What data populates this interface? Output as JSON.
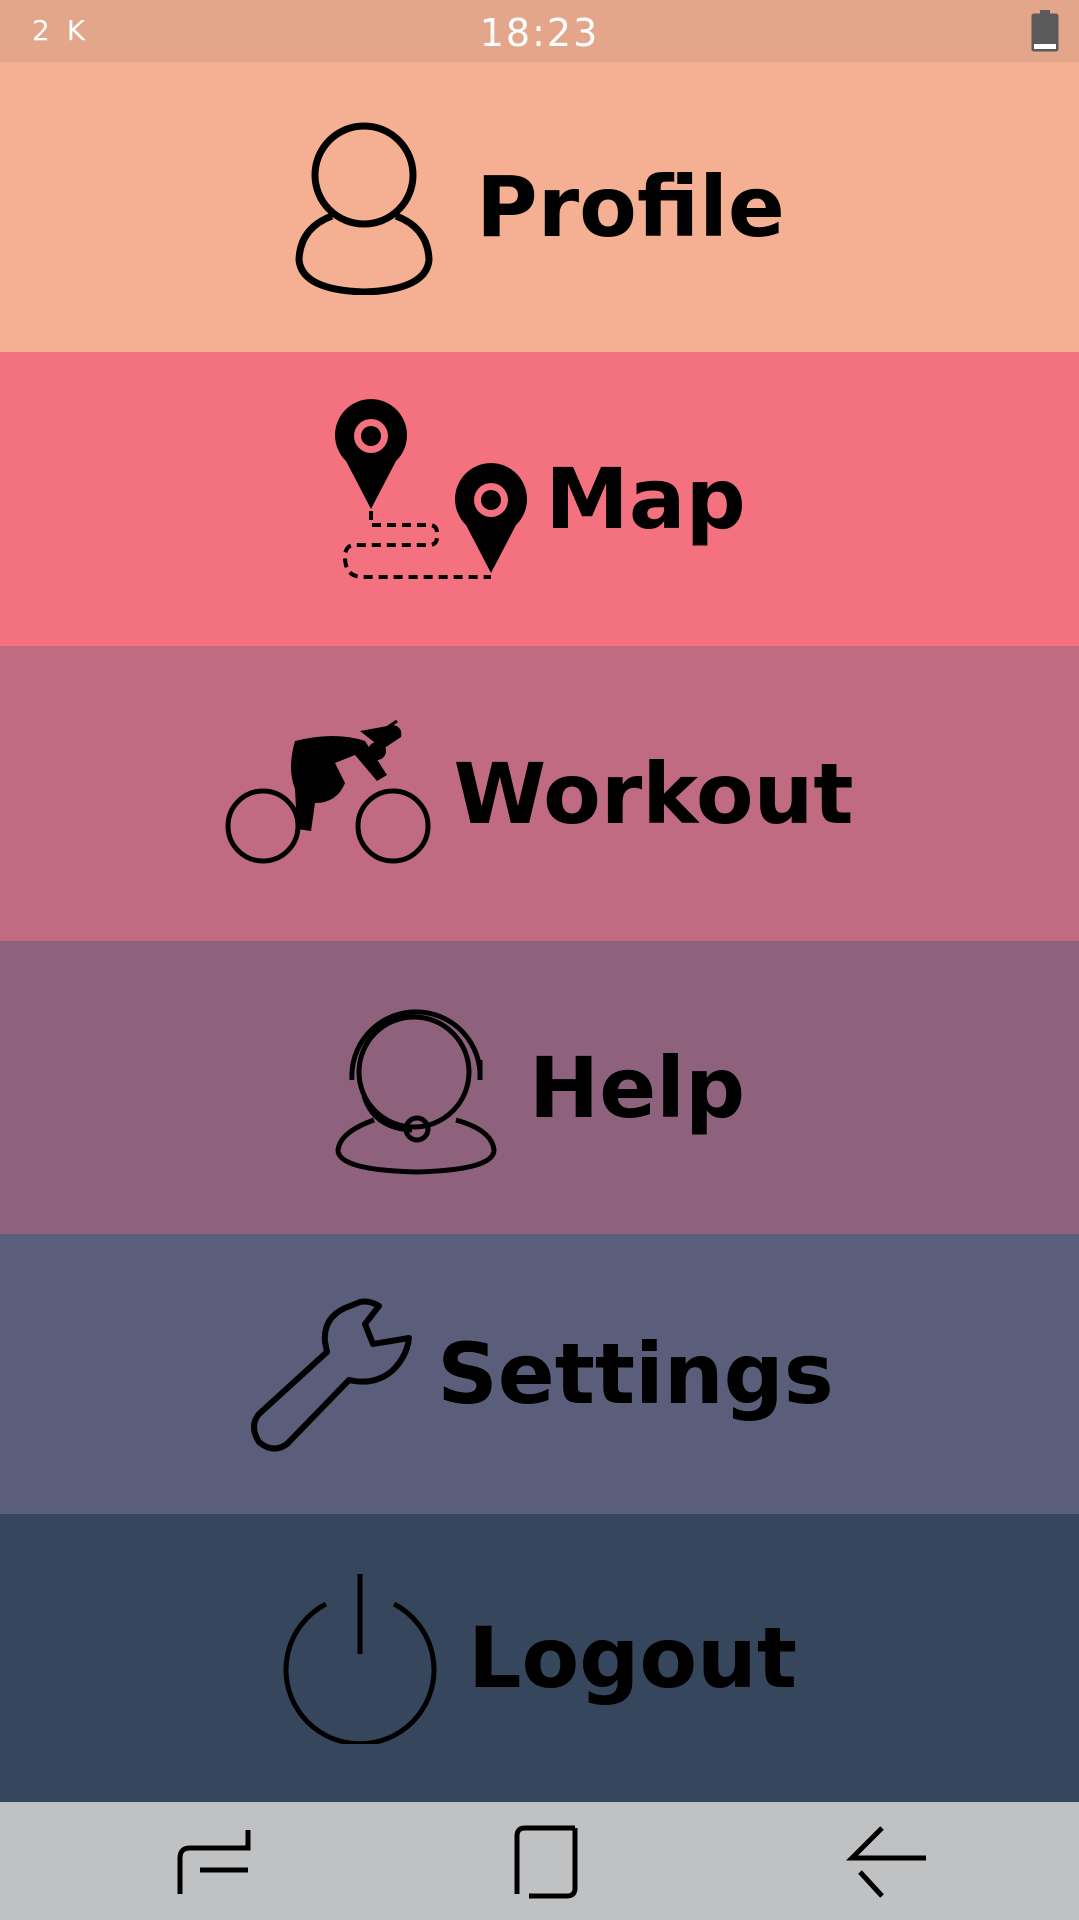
{
  "status_bar": {
    "left_text": "2 K",
    "time": "18:23",
    "battery_icon": "battery-icon"
  },
  "menu": {
    "items": [
      {
        "label": "Profile",
        "icon": "user-icon",
        "color": "#f5b093"
      },
      {
        "label": "Map",
        "icon": "map-route-icon",
        "color": "#f47280"
      },
      {
        "label": "Workout",
        "icon": "cyclist-icon",
        "color": "#c06b82"
      },
      {
        "label": "Help",
        "icon": "support-agent-icon",
        "color": "#8e627d"
      },
      {
        "label": "Settings",
        "icon": "wrench-icon",
        "color": "#5b5e7b"
      },
      {
        "label": "Logout",
        "icon": "power-icon",
        "color": "#36465d"
      }
    ]
  },
  "nav_bar": {
    "buttons": [
      {
        "icon": "recent-apps-icon"
      },
      {
        "icon": "home-icon"
      },
      {
        "icon": "back-icon"
      }
    ],
    "color": "#c0c1c3"
  }
}
